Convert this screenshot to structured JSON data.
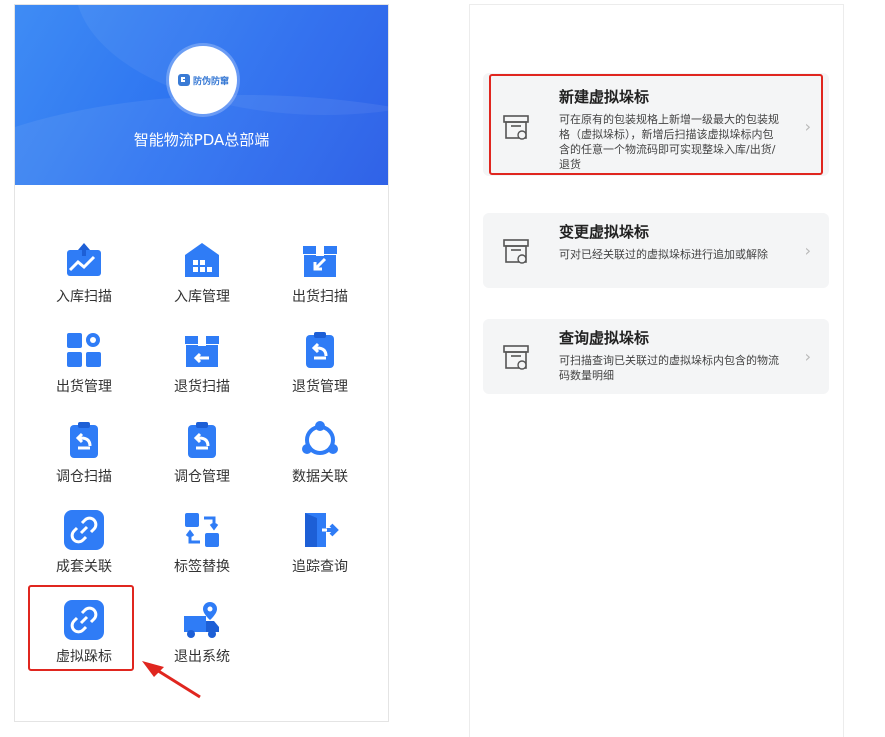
{
  "app": {
    "logo_text": "防伪防窜",
    "title": "智能物流PDA总部端"
  },
  "menu": [
    {
      "label": "入库扫描",
      "icon": "inbound-scan-icon"
    },
    {
      "label": "入库管理",
      "icon": "warehouse-icon"
    },
    {
      "label": "出货扫描",
      "icon": "outbound-box-icon"
    },
    {
      "label": "出货管理",
      "icon": "apps-grid-icon"
    },
    {
      "label": "退货扫描",
      "icon": "return-box-icon"
    },
    {
      "label": "退货管理",
      "icon": "clipboard-return-icon"
    },
    {
      "label": "调仓扫描",
      "icon": "clipboard-return-icon"
    },
    {
      "label": "调仓管理",
      "icon": "clipboard-return-icon"
    },
    {
      "label": "数据关联",
      "icon": "network-icon"
    },
    {
      "label": "成套关联",
      "icon": "link-icon"
    },
    {
      "label": "标签替换",
      "icon": "swap-icon"
    },
    {
      "label": "追踪查询",
      "icon": "exit-door-icon"
    },
    {
      "label": "虚拟跺标",
      "icon": "link-icon"
    },
    {
      "label": "退出系统",
      "icon": "delivery-truck-icon"
    }
  ],
  "cards": [
    {
      "title": "新建虚拟垛标",
      "description": "可在原有的包装规格上新增一级最大的包装规格（虚拟垛标），新增后扫描该虚拟垛标内包含的任意一个物流码即可实现整垛入库/出货/退货",
      "icon": "pallet-box-icon",
      "chevron": "›"
    },
    {
      "title": "变更虚拟垛标",
      "description": "可对已经关联过的虚拟垛标进行追加或解除",
      "icon": "pallet-box-icon",
      "chevron": "›"
    },
    {
      "title": "查询虚拟垛标",
      "description": "可扫描查询已关联过的虚拟垛标内包含的物流码数量明细",
      "icon": "pallet-box-icon",
      "chevron": "›"
    }
  ],
  "colors": {
    "primary": "#2f7cf6",
    "highlight": "#e0261f",
    "card_bg": "#f4f5f6"
  }
}
